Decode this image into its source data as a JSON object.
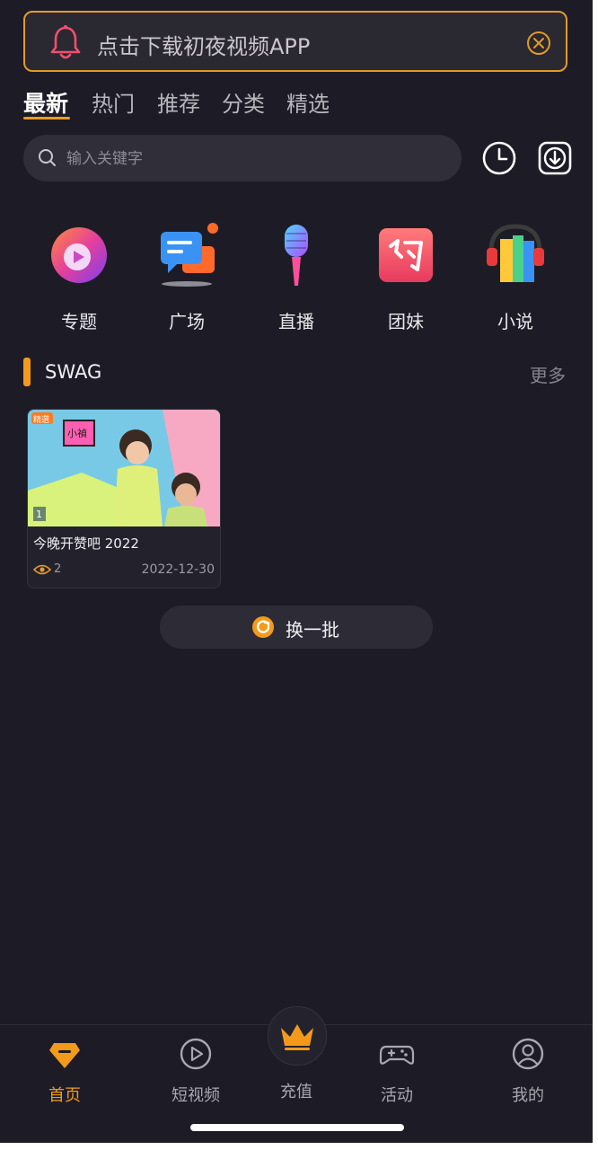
{
  "notice": {
    "text": "点击下载初夜视频APP",
    "accent": "#e09a2d",
    "bell_icon": "bell-icon",
    "close_icon": "close-circle-icon"
  },
  "tabs": [
    {
      "label": "最新",
      "active": true
    },
    {
      "label": "热门",
      "active": false
    },
    {
      "label": "推荐",
      "active": false
    },
    {
      "label": "分类",
      "active": false
    },
    {
      "label": "精选",
      "active": false
    }
  ],
  "search": {
    "placeholder": "输入关键字",
    "history_icon": "clock-icon",
    "download_icon": "download-icon"
  },
  "categories": [
    {
      "label": "专题",
      "icon": "topic-icon"
    },
    {
      "label": "广场",
      "icon": "chat-square-icon"
    },
    {
      "label": "直播",
      "icon": "microphone-icon"
    },
    {
      "label": "团妹",
      "icon": "date-badge-icon"
    },
    {
      "label": "小说",
      "icon": "books-icon"
    }
  ],
  "section": {
    "title": "SWAG",
    "more_label": "更多",
    "videos": [
      {
        "title": "今晚开赞吧 2022",
        "views": "2",
        "date": "2022-12-30",
        "badge": "精選",
        "index": "1",
        "sign_text": "小禎"
      }
    ],
    "refresh_label": "换一批"
  },
  "bottom_nav": [
    {
      "label": "首页",
      "icon": "home-diamond-icon",
      "active": true
    },
    {
      "label": "短视频",
      "icon": "play-circle-icon",
      "active": false
    },
    {
      "label": "充值",
      "icon": "crown-icon",
      "active": false
    },
    {
      "label": "活动",
      "icon": "gamepad-icon",
      "active": false
    },
    {
      "label": "我的",
      "icon": "user-icon",
      "active": false
    }
  ],
  "colors": {
    "background": "#1d1c26",
    "accent": "#f49a1b",
    "surface": "#2f2e39"
  }
}
